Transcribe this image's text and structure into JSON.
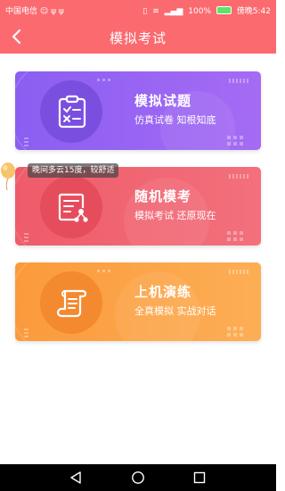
{
  "status_bar": {
    "carrier": "中国电信",
    "left_icons": "☺ ψ ψ",
    "battery_percent": "100%",
    "time": "傍晚5:42"
  },
  "nav": {
    "title": "模拟考试"
  },
  "cards": [
    {
      "title": "模拟试题",
      "subtitle": "仿真试卷  知根知底",
      "icon": "clipboard-checklist-icon",
      "color": "#8b5ef2"
    },
    {
      "title": "随机模考",
      "subtitle": "模拟考试  还原现在",
      "icon": "document-network-icon",
      "color": "#ef5b6a"
    },
    {
      "title": "上机演练",
      "subtitle": "全真模拟  实战对话",
      "icon": "scroll-icon",
      "color": "#fb9a3c"
    }
  ],
  "weather_tip": "晚间多云15度，较舒适"
}
